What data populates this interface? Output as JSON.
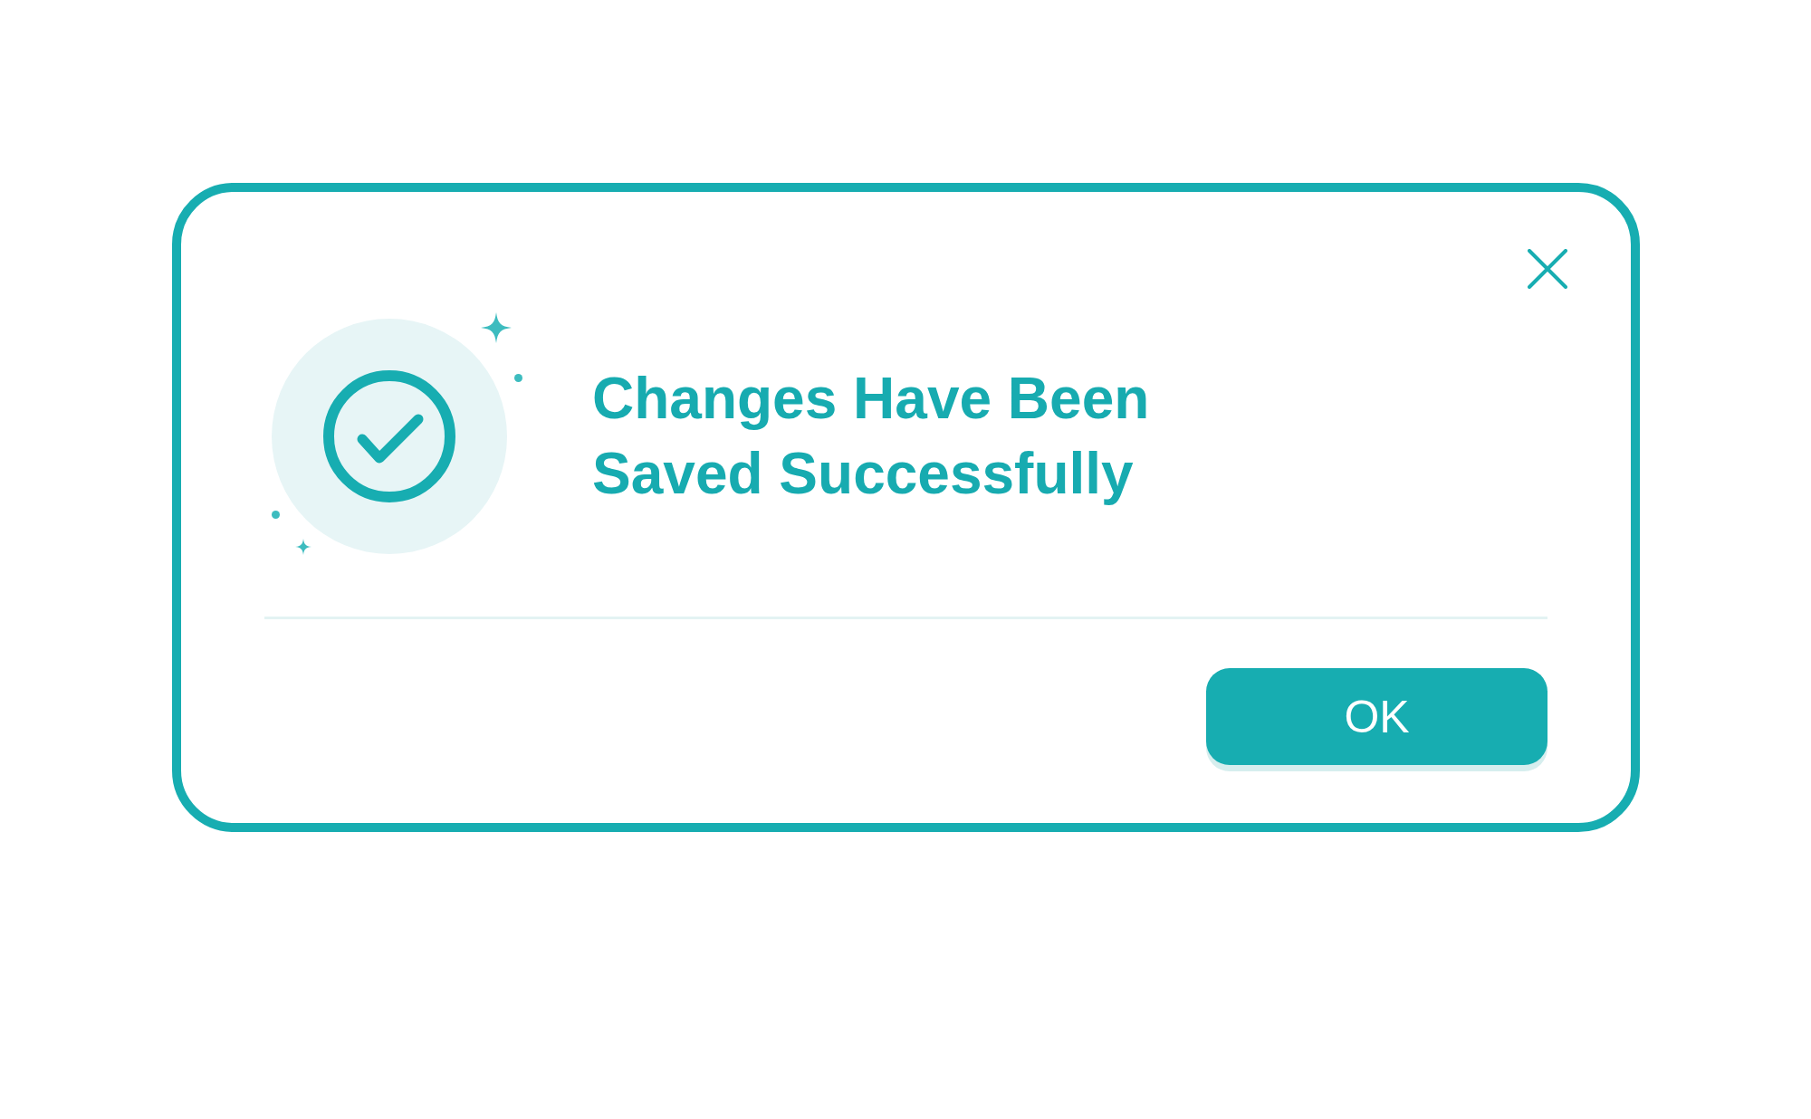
{
  "dialog": {
    "title": "Changes Have Been Saved Successfully",
    "buttons": [
      {
        "label": "OK"
      }
    ]
  }
}
